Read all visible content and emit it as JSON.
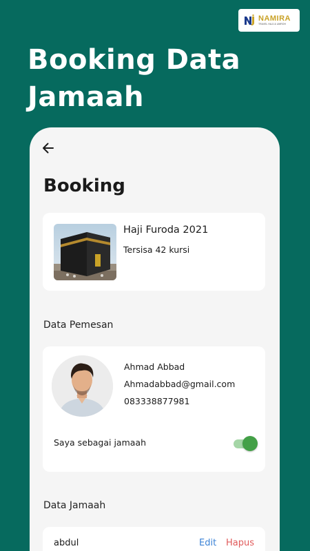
{
  "brand": {
    "name": "NAMIRA",
    "tagline": "TRAVEL HAJJ & UMROH",
    "colors": {
      "background": "#066a5e",
      "gold": "#c9a227",
      "mark_blue": "#1b3a8c"
    }
  },
  "headline": {
    "line1": "Booking Data",
    "line2": "Jamaah"
  },
  "screen": {
    "back_icon": "arrow-left-icon",
    "title": "Booking",
    "trip": {
      "name": "Haji Furoda 2021",
      "seats": "Tersisa 42 kursi"
    },
    "booker_section_label": "Data Pemesan",
    "booker": {
      "name": "Ahmad Abbad",
      "email": "Ahmadabbad@gmail.com",
      "phone": "083338877981",
      "as_pilgrim_label": "Saya sebagai jamaah",
      "as_pilgrim_on": true
    },
    "pilgrims_section_label": "Data Jamaah",
    "pilgrims": [
      {
        "name": "abdul",
        "edit_label": "Edit",
        "delete_label": "Hapus"
      }
    ],
    "colors": {
      "edit": "#3b82d6",
      "delete": "#e05a5a",
      "toggle_on": "#43a047"
    }
  }
}
